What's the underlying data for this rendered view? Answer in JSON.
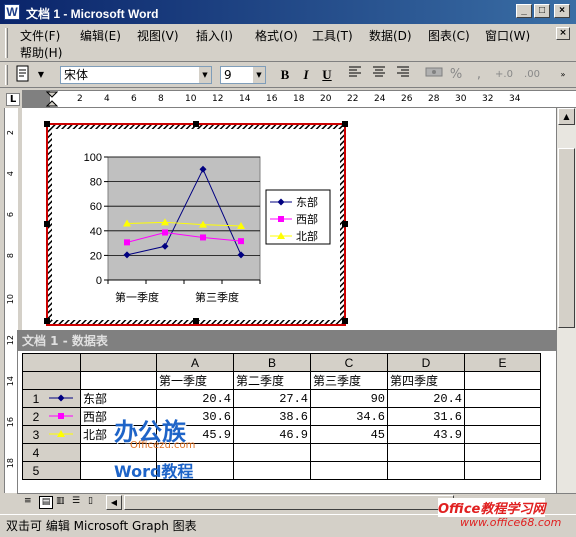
{
  "window": {
    "title": "文档 1 - Microsoft Word",
    "icon": "word-doc-icon",
    "min_label": "_",
    "max_label": "□",
    "close_label": "×",
    "close_all_label": "×"
  },
  "menu": {
    "items": [
      "文件(F)",
      "编辑(E)",
      "视图(V)",
      "插入(I)",
      "格式(O)",
      "工具(T)",
      "数据(D)",
      "图表(C)",
      "窗口(W)"
    ],
    "help": "帮助(H)"
  },
  "toolbar": {
    "font": "宋体",
    "size": "9",
    "bold": "B",
    "italic": "I",
    "underline": "U",
    "percent": "%",
    "comma": ",",
    "inc_decimal": "+.0",
    "dec_decimal": ".00"
  },
  "ruler": {
    "ticks": [
      "2",
      "4",
      "6",
      "8",
      "10",
      "12",
      "14",
      "16",
      "18",
      "20",
      "22",
      "24",
      "26",
      "28",
      "30",
      "32",
      "34"
    ],
    "tab_label": "L",
    "vticks": [
      "2",
      "4",
      "6",
      "8",
      "10",
      "12",
      "14",
      "16",
      "18"
    ]
  },
  "chart_data": {
    "type": "line",
    "categories": [
      "第一季度",
      "第二季度",
      "第三季度",
      "第四季度"
    ],
    "category_labels_shown": [
      "第一季度",
      "第三季度"
    ],
    "series": [
      {
        "name": "东部",
        "values": [
          20.4,
          27.4,
          90,
          20.4
        ],
        "color": "#000080",
        "marker": "diamond"
      },
      {
        "name": "西部",
        "values": [
          30.6,
          38.6,
          34.6,
          31.6
        ],
        "color": "#ff00ff",
        "marker": "square"
      },
      {
        "name": "北部",
        "values": [
          45.9,
          46.9,
          45,
          43.9
        ],
        "color": "#ffff00",
        "marker": "triangle"
      }
    ],
    "yticks": [
      "100",
      "80",
      "60",
      "40",
      "20",
      "0"
    ],
    "ylim": [
      0,
      100
    ],
    "grid": true,
    "legend": "right",
    "plot_bg": "#c0c0c0"
  },
  "datasheet": {
    "title": "文档 1 - 数据表",
    "col_letters": [
      "A",
      "B",
      "C",
      "D",
      "E"
    ],
    "headers": [
      "第一季度",
      "第二季度",
      "第三季度",
      "第四季度"
    ],
    "rows": [
      {
        "num": "1",
        "label": "东部",
        "values": [
          "20.4",
          "27.4",
          "90",
          "20.4"
        ]
      },
      {
        "num": "2",
        "label": "西部",
        "values": [
          "30.6",
          "38.6",
          "34.6",
          "31.6"
        ]
      },
      {
        "num": "3",
        "label": "北部",
        "values": [
          "45.9",
          "46.9",
          "45",
          "43.9"
        ]
      },
      {
        "num": "4",
        "label": "",
        "values": [
          "",
          "",
          "",
          ""
        ]
      },
      {
        "num": "5",
        "label": "",
        "values": [
          "",
          "",
          "",
          ""
        ]
      }
    ]
  },
  "status": {
    "text": "双击可 编辑 Microsoft Graph 图表"
  },
  "watermark": {
    "brand": "办公族",
    "url": "Officezu.com",
    "word": "Word教程",
    "site": "Office教程学习网",
    "site_url": "www.office68.com"
  }
}
